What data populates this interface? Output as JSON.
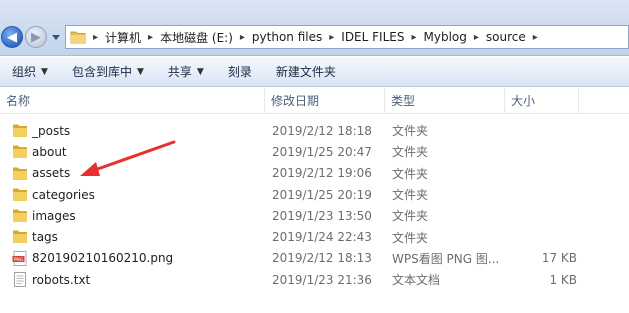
{
  "address": {
    "crumbs": [
      "计算机",
      "本地磁盘 (E:)",
      "python files",
      "IDEL FILES",
      "Myblog",
      "source"
    ]
  },
  "toolbar": {
    "organize": "组织",
    "include_in_library": "包含到库中",
    "share": "共享",
    "burn": "刻录",
    "new_folder": "新建文件夹"
  },
  "columns": {
    "name": "名称",
    "date": "修改日期",
    "type": "类型",
    "size": "大小"
  },
  "files": [
    {
      "name": "_posts",
      "date": "2019/2/12 18:18",
      "type": "文件夹",
      "size": "",
      "icon": "folder-icon"
    },
    {
      "name": "about",
      "date": "2019/1/25 20:47",
      "type": "文件夹",
      "size": "",
      "icon": "folder-icon"
    },
    {
      "name": "assets",
      "date": "2019/2/12 19:06",
      "type": "文件夹",
      "size": "",
      "icon": "folder-icon"
    },
    {
      "name": "categories",
      "date": "2019/1/25 20:19",
      "type": "文件夹",
      "size": "",
      "icon": "folder-icon"
    },
    {
      "name": "images",
      "date": "2019/1/23 13:50",
      "type": "文件夹",
      "size": "",
      "icon": "folder-icon"
    },
    {
      "name": "tags",
      "date": "2019/1/24 22:43",
      "type": "文件夹",
      "size": "",
      "icon": "folder-icon"
    },
    {
      "name": "820190210160210.png",
      "date": "2019/2/12 18:13",
      "type": "WPS看图 PNG 图...",
      "size": "17 KB",
      "icon": "png-file-icon"
    },
    {
      "name": "robots.txt",
      "date": "2019/1/23 21:36",
      "type": "文本文档",
      "size": "1 KB",
      "icon": "text-file-icon"
    }
  ],
  "colors": {
    "folder": "#e8c04e",
    "annotation_arrow": "#e8312e"
  }
}
